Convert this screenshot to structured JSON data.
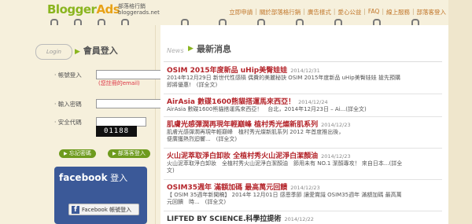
{
  "logo": {
    "text_blogger": "Blogger",
    "text_ads": "Ads",
    "sub_line1": "部落格行銷",
    "sub_line2": "bloggerads.net"
  },
  "topnav": {
    "items": [
      "立即申請",
      "關於部落格行銷",
      "廣告樣式",
      "愛心公益",
      "FAQ",
      "線上服務",
      "部落客登入"
    ],
    "separator": "|"
  },
  "login": {
    "tab_label": "Login",
    "title": "會員登入",
    "account_label": "‧ 帳號登入",
    "email_hint": "(您註冊的email)",
    "password_label": "‧ 輸入密碼",
    "captcha_label": "‧ 安全代碼",
    "captcha_text": "01188",
    "forgot_button": "忘記密碼",
    "signup_button": "部落客登入"
  },
  "facebook": {
    "title": "facebook",
    "title_suffix": " 登入",
    "button_label": "Facebook 帳號登入",
    "button_icon": "f"
  },
  "news": {
    "header_en": "News",
    "header": "最新消息",
    "items": [
      {
        "title": "OSIM 2015年度新品 uHip美臀娃娃",
        "date": "2014/12/31",
        "body": [
          "2014年12月29日 新世代性感隕 偶費的美麗秘訣 OSIM 2015年度新品 uHip美臀娃娃 搶先預購",
          "即將優惠!　(詳全文)"
        ]
      },
      {
        "title": "AirAsia 數碟1600熊貓搭運馬來西亞！",
        "date": "2014/12/24",
        "body": [
          "AirAsia 數碟1600熊貓搭運馬來西亞！　台北，2014年12月23日 – Ai...(詳全文)"
        ]
      },
      {
        "title": "肌膚光感彈潤再現年輕巔峰 植村秀光燦新肌系列",
        "date": "2014/12/23",
        "body": [
          "肌膚光感彈潤再現年輕巔峰　植村秀光燦新肌系列 2012 年首度推出後，",
          "便廣獲熱烈迴響...　(詳全文)"
        ]
      },
      {
        "title": "火山泥萃取淨白卸妝 全植村秀火山泥淨白潔顏油",
        "date": "2014/12/23",
        "body": [
          "火山泥萃取淨白卸妝　全植村秀火山泥淨白潔顏油　節用未有 NO.1 潔顏專攻！ 來自日本...(詳全",
          "文)"
        ]
      },
      {
        "title": "OSIM35週年 滿額加碼 最高萬元回饋",
        "date": "2014/12/23",
        "body": [
          "【 OSIM 35週年新聞稿】 2014年 12月01日 感恩季節 讓愛賞識 OSIM35週年 滿額加碼 最高萬",
          "元回饋　時...　(詳全文)"
        ]
      },
      {
        "title": "LIFTED BY SCIENCE.科學拉提術",
        "date": "2014/12/22",
        "body": []
      }
    ]
  }
}
